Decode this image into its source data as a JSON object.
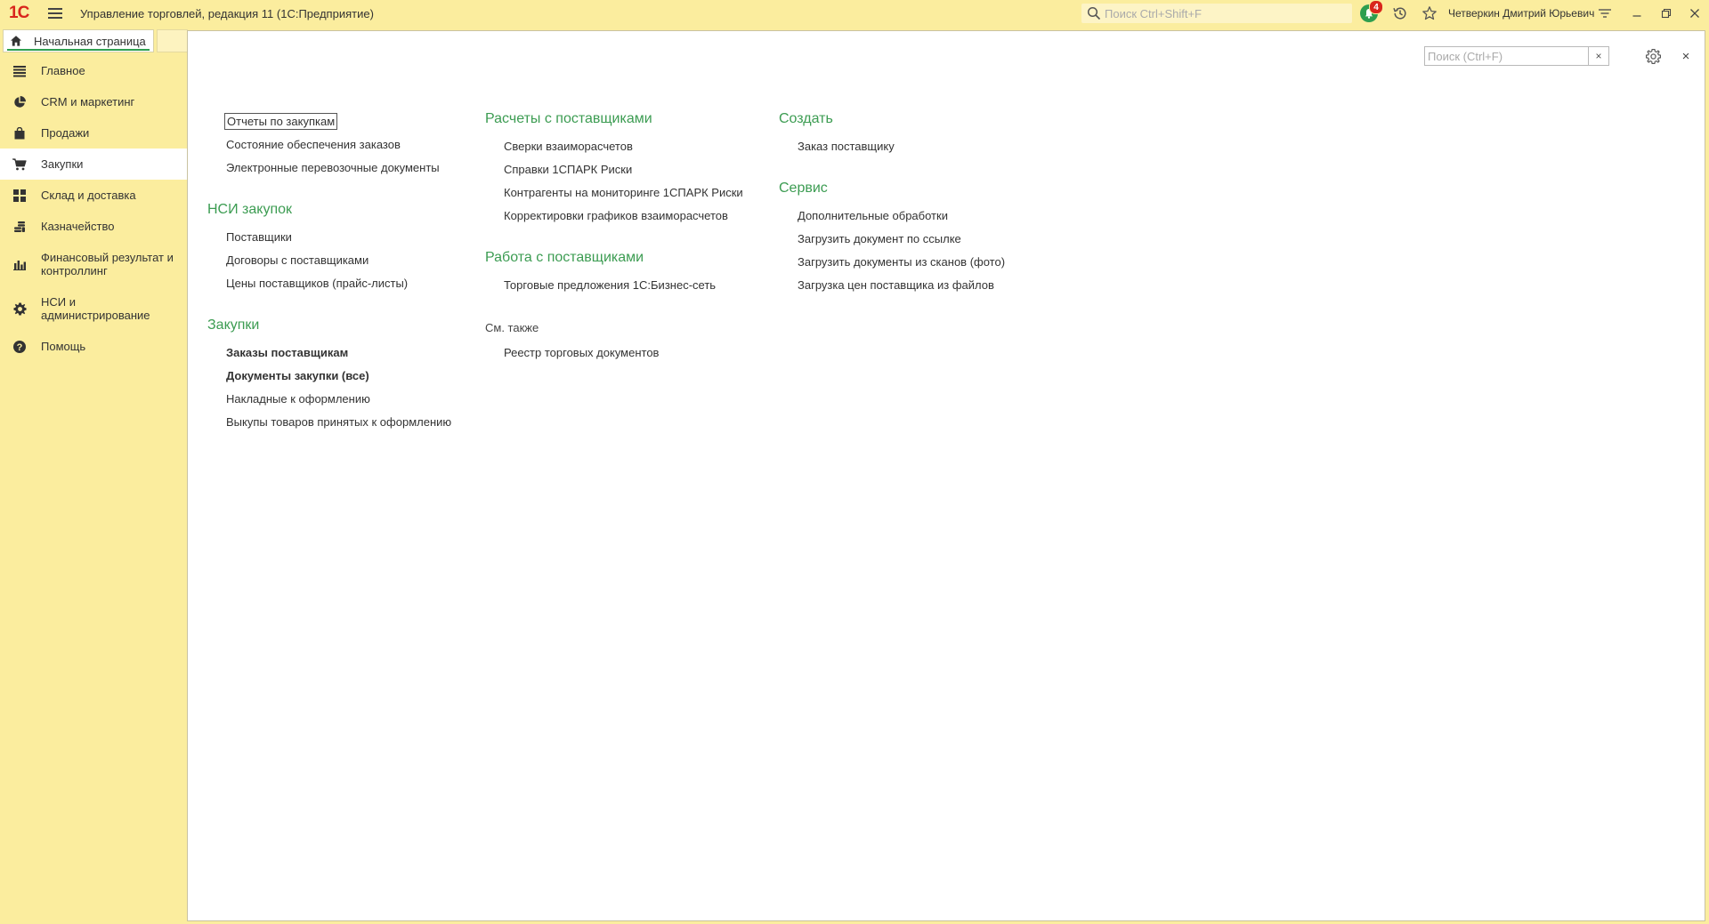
{
  "titlebar": {
    "logo_text": "1С",
    "app_title": "Управление торговлей, редакция 11  (1С:Предприятие)",
    "search_placeholder": "Поиск Ctrl+Shift+F",
    "notifications_count": "4",
    "user_name": "Четверкин Дмитрий Юрьевич"
  },
  "tabs": {
    "home_label": "Начальная страница"
  },
  "sidebar": {
    "items": [
      {
        "label": "Главное",
        "icon": "list-icon"
      },
      {
        "label": "CRM и маркетинг",
        "icon": "pie-chart-icon"
      },
      {
        "label": "Продажи",
        "icon": "shopping-bag-icon"
      },
      {
        "label": "Закупки",
        "icon": "cart-icon",
        "active": true
      },
      {
        "label": "Склад и доставка",
        "icon": "grid-icon"
      },
      {
        "label": "Казначейство",
        "icon": "coins-icon"
      },
      {
        "label": "Финансовый результат и контроллинг",
        "icon": "bar-chart-icon"
      },
      {
        "label": "НСИ и администрирование",
        "icon": "gear-icon"
      },
      {
        "label": "Помощь",
        "icon": "help-icon"
      }
    ]
  },
  "panel": {
    "search_placeholder": "Поиск (Ctrl+F)",
    "clear_label": "×",
    "close_label": "×"
  },
  "content": {
    "col1": {
      "top_links": [
        "Отчеты по закупкам",
        "Состояние обеспечения заказов",
        "Электронные перевозочные документы"
      ],
      "nsi_title": "НСИ закупок",
      "nsi_links": [
        "Поставщики",
        "Договоры с поставщиками",
        "Цены поставщиков (прайс-листы)"
      ],
      "purchases_title": "Закупки",
      "purchases_links": [
        "Заказы поставщикам",
        "Документы закупки (все)",
        "Накладные к оформлению",
        "Выкупы товаров принятых к оформлению"
      ]
    },
    "col2": {
      "settlements_title": "Расчеты с поставщиками",
      "settlements_links": [
        "Сверки взаиморасчетов",
        "Справки 1СПАРК Риски",
        "Контрагенты на мониторинге 1СПАРК Риски",
        "Корректировки графиков взаиморасчетов"
      ],
      "work_title": "Работа с поставщиками",
      "work_links": [
        "Торговые предложения 1С:Бизнес-сеть"
      ],
      "see_also_title": "См. также",
      "see_also_links": [
        "Реестр торговых документов"
      ]
    },
    "col3": {
      "create_title": "Создать",
      "create_links": [
        "Заказ поставщику"
      ],
      "service_title": "Сервис",
      "service_links": [
        "Дополнительные обработки",
        "Загрузить документ по ссылке",
        "Загрузить документы из сканов (фото)",
        "Загрузка цен поставщика из файлов"
      ]
    }
  },
  "colors": {
    "background": "#fbed9e",
    "accent_green": "#3c9c52",
    "logo_red": "#d9261c"
  }
}
